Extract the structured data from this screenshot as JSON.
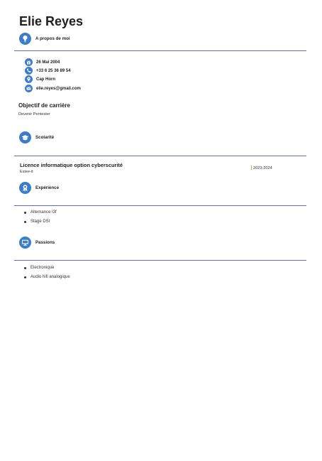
{
  "name": "Elie Reyes",
  "about": {
    "title": "A propos de moi",
    "icon": "lightbulb-icon",
    "contacts": [
      {
        "icon": "gift-icon",
        "text": "26 Mai 2004"
      },
      {
        "icon": "phone-icon",
        "text": "+33 6 25 36 89 54"
      },
      {
        "icon": "map-pin-icon",
        "text": "Cap Horn"
      },
      {
        "icon": "envelope-icon",
        "text": "elie.reyes@gmail.com"
      }
    ]
  },
  "objective": {
    "title": "Objectif de carrière",
    "text": "Devenir Pentester"
  },
  "education": {
    "title": "Scolarité",
    "icon": "graduation-cap-icon",
    "entries": [
      {
        "degree": "Licence informatique option cyberscurité",
        "school": "Esiee-it",
        "dates": "2023-2024"
      }
    ]
  },
  "experience": {
    "title": "Expérience",
    "icon": "award-icon",
    "items": [
      "Altemance I3f",
      "Stage DSI"
    ]
  },
  "passions": {
    "title": "Passions",
    "icon": "monitor-icon",
    "items": [
      "Electronique",
      "Audio hifi analogique"
    ]
  },
  "colors": {
    "accent": "#3d7cc9",
    "rule": "#5b6fae",
    "date_marker": "#e0a030"
  }
}
